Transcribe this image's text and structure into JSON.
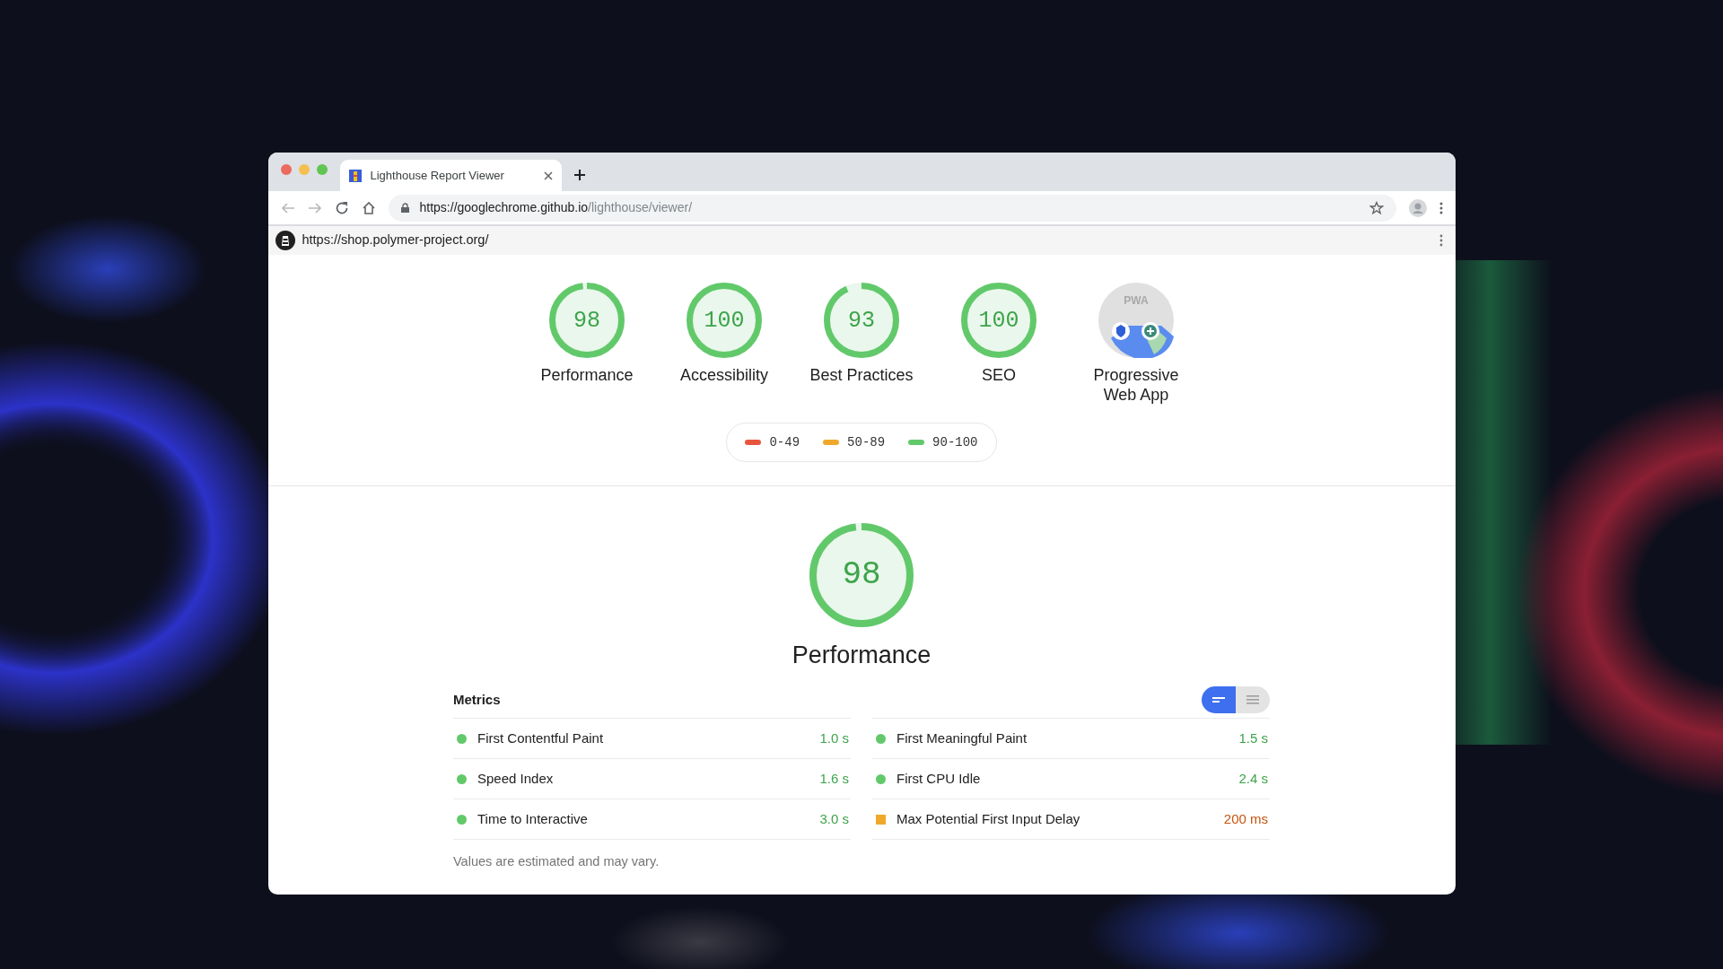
{
  "browser": {
    "tabs": [
      {
        "title": "Lighthouse Report Viewer",
        "selected": true
      }
    ],
    "address": {
      "host": "https://googlechrome.github.io",
      "path": "/lighthouse/viewer/"
    }
  },
  "report": {
    "url": "https://shop.polymer-project.org/",
    "gauges": [
      {
        "kind": "score",
        "score": "98",
        "level": 0.98,
        "label": "Performance"
      },
      {
        "kind": "score",
        "score": "100",
        "level": 1,
        "label": "Accessibility"
      },
      {
        "kind": "score",
        "score": "93",
        "level": 0.93,
        "label": "Best Practices"
      },
      {
        "kind": "score",
        "score": "100",
        "level": 1,
        "label": "SEO"
      },
      {
        "kind": "pwa",
        "badge": "PWA",
        "label": "Progressive Web App"
      }
    ],
    "legend": [
      {
        "range": "0-49",
        "color": "#e8553f"
      },
      {
        "range": "50-89",
        "color": "#f0a82b"
      },
      {
        "range": "90-100",
        "color": "#62c96b"
      }
    ],
    "category": {
      "score": "98",
      "level": 0.98,
      "title": "Performance"
    },
    "metrics": {
      "title": "Metrics",
      "view_toggle": [
        {
          "kind": "compact",
          "selected": true
        },
        {
          "kind": "list",
          "selected": false
        }
      ],
      "items": [
        {
          "name": "First Contentful Paint",
          "value": "1.0 s",
          "kind": "pass"
        },
        {
          "name": "First Meaningful Paint",
          "value": "1.5 s",
          "kind": "pass"
        },
        {
          "name": "Speed Index",
          "value": "1.6 s",
          "kind": "pass"
        },
        {
          "name": "First CPU Idle",
          "value": "2.4 s",
          "kind": "pass"
        },
        {
          "name": "Time to Interactive",
          "value": "3.0 s",
          "kind": "pass"
        },
        {
          "name": "Max Potential First Input Delay",
          "value": "200 ms",
          "kind": "average"
        }
      ],
      "note": "Values are estimated and may vary."
    }
  }
}
